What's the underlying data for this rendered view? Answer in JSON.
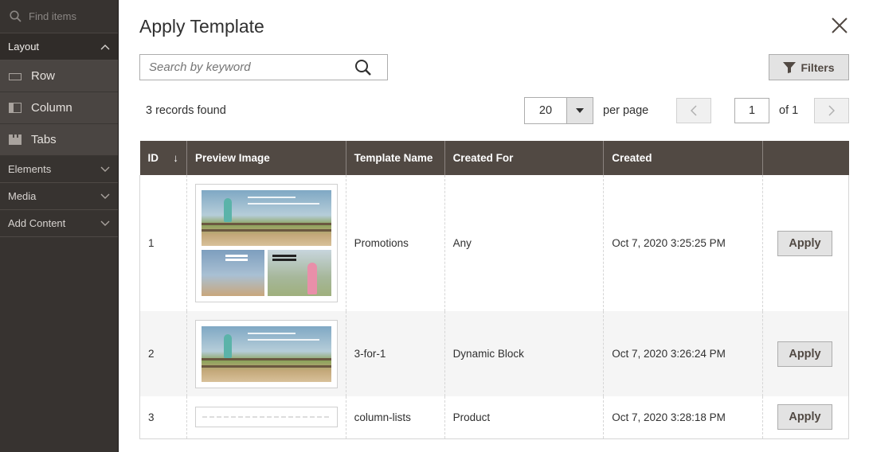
{
  "sidebar": {
    "search_placeholder": "Find items",
    "groups": [
      {
        "label": "Layout",
        "open": true
      },
      {
        "label": "Elements",
        "open": false
      },
      {
        "label": "Media",
        "open": false
      },
      {
        "label": "Add Content",
        "open": false
      }
    ],
    "layout_items": [
      {
        "label": "Row",
        "icon": "row-icon"
      },
      {
        "label": "Column",
        "icon": "column-icon"
      },
      {
        "label": "Tabs",
        "icon": "tabs-icon"
      }
    ]
  },
  "modal": {
    "title": "Apply Template",
    "search_placeholder": "Search by keyword",
    "filters_label": "Filters",
    "records_found": "3 records found",
    "per_page_value": "20",
    "per_page_label": "per page",
    "page_current": "1",
    "page_of": "of 1"
  },
  "table": {
    "columns": [
      "ID",
      "Preview Image",
      "Template Name",
      "Created For",
      "Created",
      ""
    ],
    "sort_indicator": "↓",
    "rows": [
      {
        "id": "1",
        "preview": "promotions",
        "name": "Promotions",
        "created_for": "Any",
        "created": "Oct 7, 2020 3:25:25 PM",
        "action": "Apply"
      },
      {
        "id": "2",
        "preview": "banner",
        "name": "3-for-1",
        "created_for": "Dynamic Block",
        "created": "Oct 7, 2020 3:26:24 PM",
        "action": "Apply"
      },
      {
        "id": "3",
        "preview": "lists",
        "name": "column-lists",
        "created_for": "Product",
        "created": "Oct 7, 2020 3:28:18 PM",
        "action": "Apply"
      }
    ]
  },
  "colors": {
    "sidebar_bg": "#373330",
    "header_bg": "#514943",
    "button_bg": "#e3e3e3"
  }
}
